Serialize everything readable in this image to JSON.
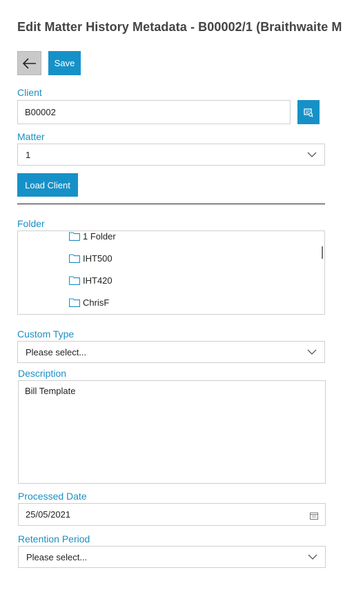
{
  "page": {
    "title": "Edit Matter History Metadata - B00002/1 (Braithwaite  M"
  },
  "toolbar": {
    "save_label": "Save"
  },
  "client": {
    "label": "Client",
    "value": "B00002"
  },
  "matter": {
    "label": "Matter",
    "value": "1"
  },
  "load_client": {
    "label": "Load Client"
  },
  "folder": {
    "label": "Folder",
    "items": [
      "1 Folder",
      "IHT500",
      "IHT420",
      "ChrisF"
    ]
  },
  "custom_type": {
    "label": "Custom Type",
    "value": "Please select..."
  },
  "description": {
    "label": "Description",
    "value": "Bill Template"
  },
  "processed_date": {
    "label": "Processed Date",
    "value": "25/05/2021"
  },
  "retention_period": {
    "label": "Retention Period",
    "value": "Please select..."
  },
  "colors": {
    "accent": "#1691c8",
    "border": "#cfcfcf",
    "back_button": "#c9c9c9"
  }
}
